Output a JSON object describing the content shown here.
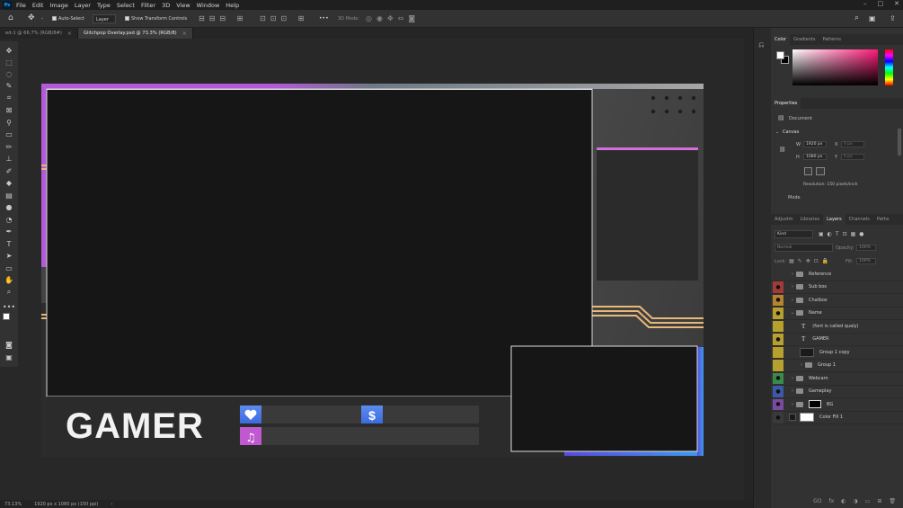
{
  "menu": {
    "logo": "Ps",
    "items": [
      "File",
      "Edit",
      "Image",
      "Layer",
      "Type",
      "Select",
      "Filter",
      "3D",
      "View",
      "Window",
      "Help"
    ]
  },
  "window_controls": [
    "–",
    "□",
    "✕"
  ],
  "options": {
    "auto_select": "Auto-Select",
    "layer_select": "Layer",
    "transform": "Show Transform Controls",
    "mode_3d": "3D Mode:",
    "more": "•••"
  },
  "tabs": [
    {
      "label": "ed-1 @ 66.7% (RGB/8#)",
      "active": false
    },
    {
      "label": "Glitchpop Overlay.psd @ 73.3% (RGB/8)",
      "active": true
    }
  ],
  "overlay": {
    "gamer_text": "GAMER",
    "dollar_icon": "$"
  },
  "status": {
    "zoom": "73.13%",
    "doc_size": "1920 px x 1080 px (150 ppi)",
    "arrow": "›"
  },
  "color_panel": {
    "tabs": [
      "Color",
      "Gradients",
      "Patterns"
    ]
  },
  "properties": {
    "title": "Properties",
    "doc_label": "Document",
    "canvas_label": "Canvas",
    "w_label": "W",
    "w_value": "1920 px",
    "h_label": "H",
    "h_value": "1080 px",
    "x_label": "X",
    "x_value": "0 px",
    "y_label": "Y",
    "y_value": "0 px",
    "resolution": "Resolution: 150 pixels/inch",
    "mode_label": "Mode"
  },
  "layers_panel": {
    "tabs": [
      "Adjustm",
      "Libraries",
      "Layers",
      "Channels",
      "Paths"
    ],
    "kind": "Kind",
    "blend": "Normal",
    "opacity_label": "Opacity:",
    "opacity": "100%",
    "lock_label": "Lock:",
    "fill_label": "Fill:",
    "fill": "100%",
    "layers": [
      {
        "name": "Reference",
        "type": "folder",
        "eye": "",
        "color": "#323232",
        "indent": 0
      },
      {
        "name": "Sub box",
        "type": "folder",
        "eye": "●",
        "color": "#a33a3a",
        "indent": 0
      },
      {
        "name": "Chatbox",
        "type": "folder",
        "eye": "●",
        "color": "#b8832e",
        "indent": 0
      },
      {
        "name": "Name",
        "type": "folder-open",
        "eye": "●",
        "color": "#b8a02e",
        "indent": 0
      },
      {
        "name": "(font is called qualy)",
        "type": "text",
        "eye": "",
        "color": "#b8a02e",
        "indent": 1
      },
      {
        "name": "GAMER",
        "type": "text",
        "eye": "●",
        "color": "#b8a02e",
        "indent": 1
      },
      {
        "name": "Group 1 copy",
        "type": "thumb",
        "eye": "",
        "color": "#b8a02e",
        "indent": 1
      },
      {
        "name": "Group 1",
        "type": "folder",
        "eye": "",
        "color": "#b8a02e",
        "indent": 1
      },
      {
        "name": "Webcam",
        "type": "folder",
        "eye": "●",
        "color": "#3a8a4a",
        "indent": 0
      },
      {
        "name": "Gameplay",
        "type": "folder",
        "eye": "●",
        "color": "#3a5aa8",
        "indent": 0
      },
      {
        "name": "BG",
        "type": "folder-mask",
        "eye": "●",
        "color": "#7a4aa0",
        "indent": 0
      },
      {
        "name": "Color Fill 1",
        "type": "fill",
        "eye": "●",
        "color": "#3a3a3a",
        "indent": 0
      }
    ],
    "bottom_icons": [
      "GO",
      "fx",
      "◐",
      "◑",
      "▭",
      "⊞",
      "🗑"
    ]
  }
}
